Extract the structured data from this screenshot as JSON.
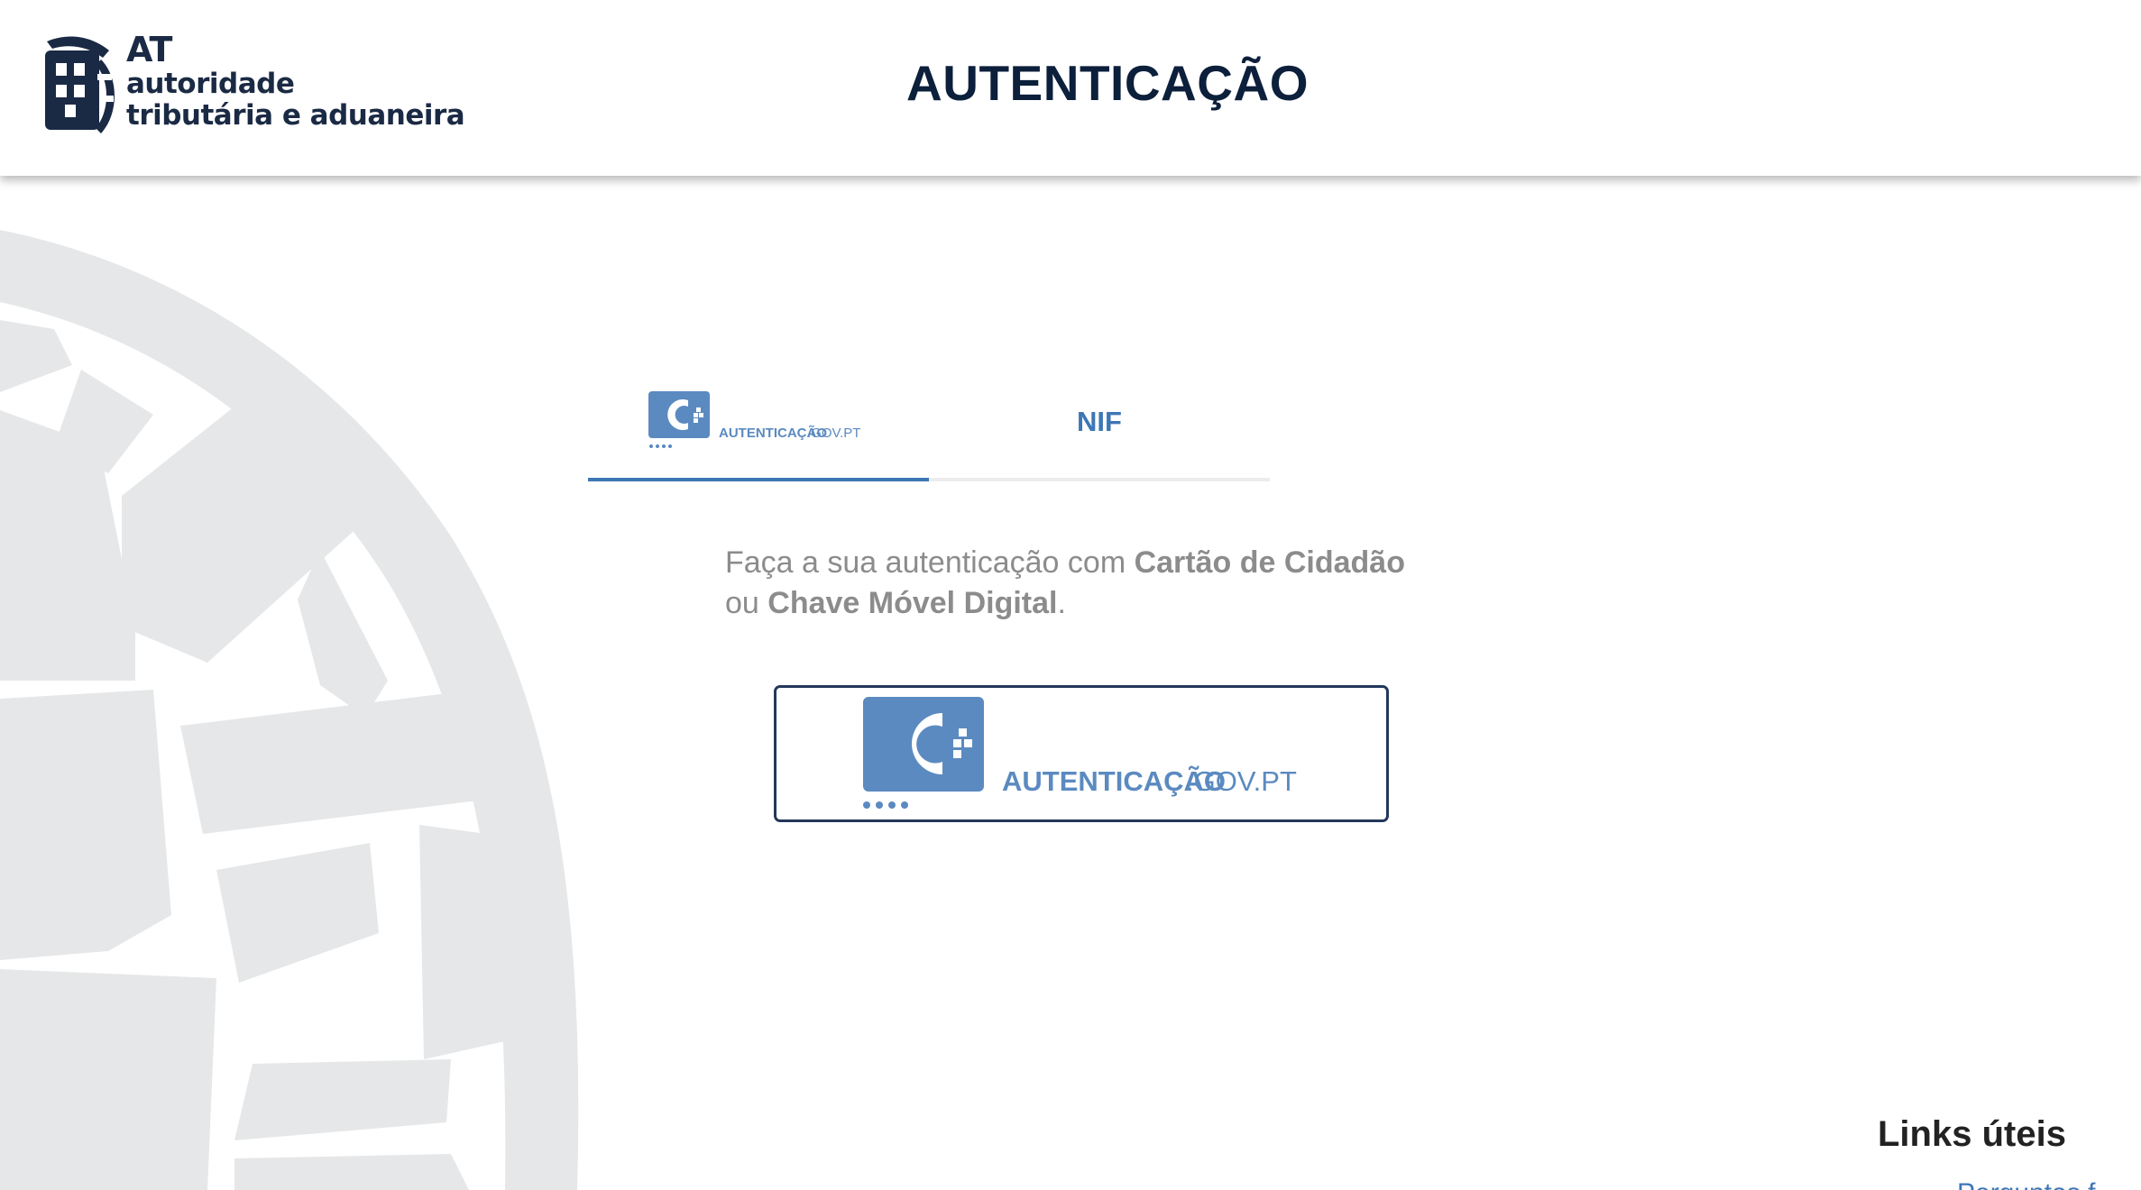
{
  "header": {
    "logo": {
      "abbr": "AT",
      "line1": "autoridade",
      "line2": "tributária e aduaneira"
    },
    "title": "AUTENTICAÇÃO"
  },
  "tabs": [
    {
      "label": "AUTENTICAÇÃO.GOV.PT",
      "active": true
    },
    {
      "label": "NIF",
      "active": false
    }
  ],
  "instruction": {
    "prefix": "Faça a sua autenticação com ",
    "bold1": "Cartão de Cidadão",
    "middle": "ou ",
    "bold2": "Chave Móvel Digital",
    "suffix": "."
  },
  "login_button": {
    "brand_main": "AUTENTICAÇÃO",
    "brand_domain": ".GOV.PT"
  },
  "links": {
    "heading": "Links úteis",
    "first_item": "Perguntas f"
  },
  "colors": {
    "title": "#0c1f3b",
    "accent_blue": "#3d77b5",
    "brand_blue": "#5b8ac0",
    "button_border": "#23385a",
    "instruction_gray": "#8c8c8c",
    "watermark_gray": "#e6e7e8"
  },
  "icons": [
    "at-emblem-icon",
    "autenticacao-gov-logo-icon"
  ]
}
